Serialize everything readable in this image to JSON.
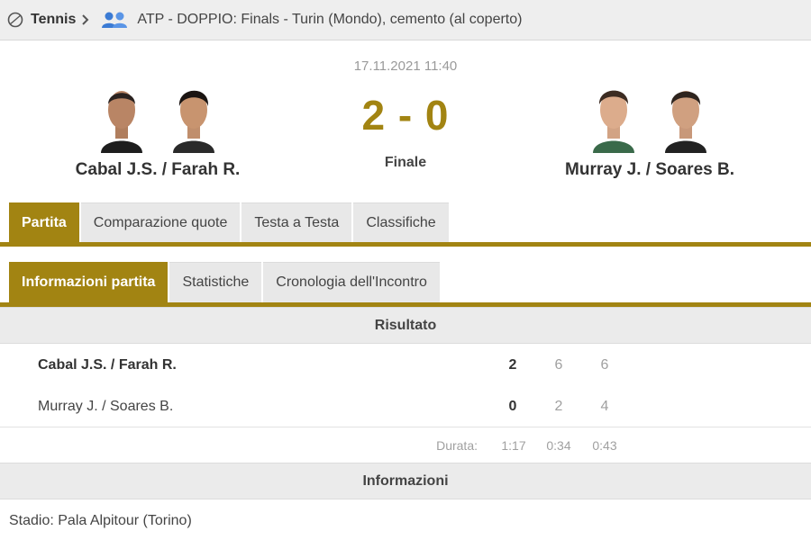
{
  "breadcrumb": {
    "sport": "Tennis",
    "tournament": "ATP - DOPPIO: Finals - Turin (Mondo), cemento (al coperto)"
  },
  "match": {
    "date": "17.11.2021 11:40",
    "score": "2 - 0",
    "status": "Finale",
    "home": {
      "name": "Cabal J.S. / Farah R."
    },
    "away": {
      "name": "Murray J. / Soares B."
    }
  },
  "tabs_main": [
    {
      "label": "Partita",
      "active": true
    },
    {
      "label": "Comparazione quote",
      "active": false
    },
    {
      "label": "Testa a Testa",
      "active": false
    },
    {
      "label": "Classifiche",
      "active": false
    }
  ],
  "tabs_sub": [
    {
      "label": "Informazioni partita",
      "active": true
    },
    {
      "label": "Statistiche",
      "active": false
    },
    {
      "label": "Cronologia dell'Incontro",
      "active": false
    }
  ],
  "result": {
    "title": "Risultato",
    "rows": [
      {
        "name": "Cabal J.S. / Farah R.",
        "sets": "2",
        "set1": "6",
        "set2": "6",
        "winner": true
      },
      {
        "name": "Murray J. / Soares B.",
        "sets": "0",
        "set1": "2",
        "set2": "4",
        "winner": false
      }
    ],
    "duration": {
      "label": "Durata:",
      "total": "1:17",
      "set1": "0:34",
      "set2": "0:43"
    }
  },
  "info": {
    "title": "Informazioni",
    "venue": "Stadio: Pala Alpitour (Torino)"
  },
  "colors": {
    "accent": "#a28412",
    "tab_bg": "#e8e8e8",
    "section_bg": "#ebebeb"
  },
  "icons": {
    "sport": "tennis-ball-icon",
    "chevron": "chevron-right-icon",
    "doubles": "people-icon"
  }
}
